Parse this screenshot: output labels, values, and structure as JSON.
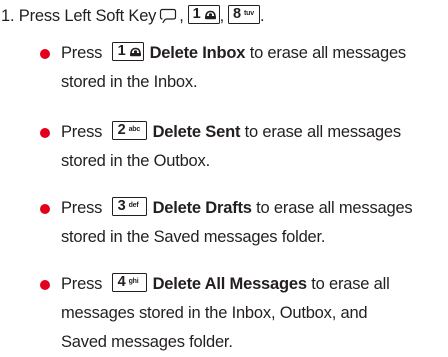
{
  "step": {
    "number": "1.",
    "press": "Press",
    "soft_key_name": "Left Soft Key",
    "sep1": ",",
    "sep2": ",",
    "end": ".",
    "keys": [
      {
        "num": "1",
        "sub": "voicemail-icon"
      },
      {
        "num": "8",
        "sub": "tuv"
      }
    ]
  },
  "options": [
    {
      "press": "Press",
      "key_num": "1",
      "key_sub": "voicemail-icon",
      "option_label": "Delete Inbox",
      "line1_rest": "to erase all messages",
      "line2": "stored in the Inbox.",
      "line3": ""
    },
    {
      "press": "Press",
      "key_num": "2",
      "key_sub": "abc",
      "option_label": "Delete Sent",
      "line1_rest": "to erase all messages",
      "line2": "stored in the Outbox.",
      "line3": ""
    },
    {
      "press": "Press",
      "key_num": "3",
      "key_sub": "def",
      "option_label": "Delete Drafts",
      "line1_rest": "to erase all messages",
      "line2": "stored in the Saved messages folder.",
      "line3": ""
    },
    {
      "press": "Press",
      "key_num": "4",
      "key_sub": "ghi",
      "option_label": "Delete All Messages",
      "line1_rest": "to erase all",
      "line2": "messages stored in the Inbox, Outbox, and",
      "line3": "Saved messages folder."
    }
  ],
  "colors": {
    "text": "#231f20",
    "bullet": "#e2001a",
    "background": "#ffffff"
  }
}
